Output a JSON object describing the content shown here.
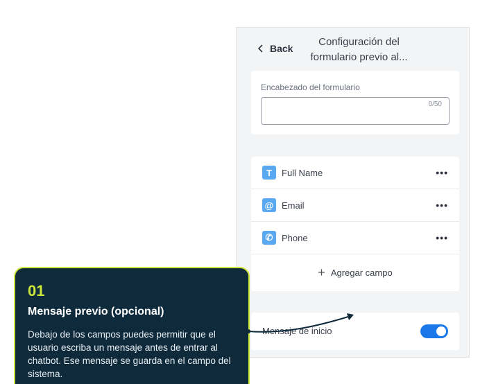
{
  "header": {
    "back_label": "Back",
    "title": "Configuración del formulario previo al..."
  },
  "form_header": {
    "label": "Encabezado del formulario",
    "value": "",
    "counter": "0/50"
  },
  "fields": [
    {
      "name": "Full Name",
      "icon": "text-icon",
      "glyph": "T"
    },
    {
      "name": "Email",
      "icon": "at-icon",
      "glyph": "@"
    },
    {
      "name": "Phone",
      "icon": "phone-icon",
      "glyph": "✆"
    }
  ],
  "more_glyph": "•••",
  "add_field_label": "Agregar campo",
  "start_message": {
    "label": "Mensaje de inicio",
    "enabled": true
  },
  "callout": {
    "step": "01",
    "title": "Mensaje previo (opcional)",
    "body": "Debajo de los campos puedes permitir que el usuario escriba un mensaje antes de entrar al chatbot. Ese mensaje se guarda en el campo del sistema."
  },
  "colors": {
    "accent": "#1a78e8",
    "icon_bg": "#5aa9f0",
    "callout_bg": "#0f2a3b",
    "callout_accent": "#cde83a"
  }
}
